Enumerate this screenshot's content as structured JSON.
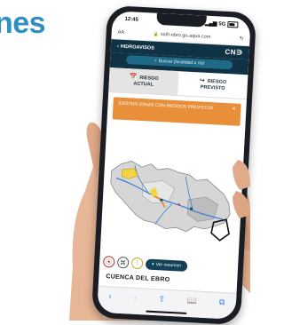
{
  "page": {
    "title": "nes"
  },
  "status_bar": {
    "time": "12:45",
    "network": "5G"
  },
  "browser": {
    "text_size": "AA",
    "url": "saih-ebro.go-aqua.com",
    "reload": "↻"
  },
  "app_header": {
    "back_label": "HIDROAVISOS",
    "back_arrow": "‹",
    "logo": "CN∋"
  },
  "search": {
    "placeholder": "Buscar (localidad o río)",
    "icon": "search-icon"
  },
  "tabs": [
    {
      "icon": "📅",
      "line1": "RIESGO",
      "line2": "ACTUAL",
      "active": true
    },
    {
      "icon": "↪",
      "line1": "RIESGO",
      "line2": "PREVISTO",
      "active": false
    }
  ],
  "alert": {
    "text": "EXISTEN ZONAS CON RIESGOS PREVISTOS",
    "close": "×",
    "color": "#e98f3a"
  },
  "map_controls": {
    "pin": "⦿",
    "share": "⌘",
    "info": "!",
    "summary_label": "Ver resumen",
    "summary_icon": "▾"
  },
  "section": {
    "title": "CUENCA DEL EBRO"
  },
  "bottom_bar": {
    "back": "‹",
    "forward": "›",
    "share": "⇪",
    "bookmarks": "📖",
    "tabs": "⧉"
  },
  "colors": {
    "brand_dark": "#0f3344",
    "accent_blue": "#2f8fc3",
    "alert_orange": "#e98f3a"
  }
}
